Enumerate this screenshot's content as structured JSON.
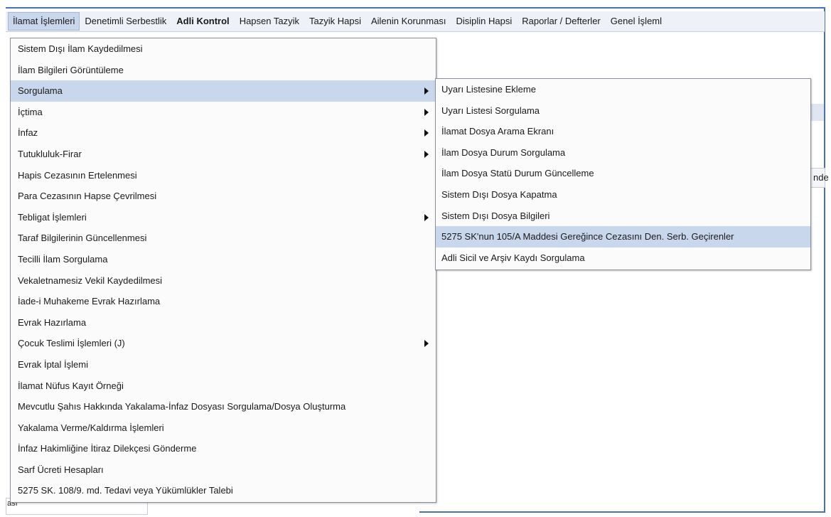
{
  "menubar": {
    "items": [
      {
        "label": "İlamat İşlemleri",
        "active": true
      },
      {
        "label": "Denetimli Serbestlik"
      },
      {
        "label": "Adli Kontrol",
        "bold": true
      },
      {
        "label": "Hapsen Tazyik"
      },
      {
        "label": "Tazyik Hapsi"
      },
      {
        "label": "Ailenin Korunması"
      },
      {
        "label": "Disiplin Hapsi"
      },
      {
        "label": "Raporlar / Defterler"
      },
      {
        "label": "Genel İşleml"
      }
    ]
  },
  "main_menu": {
    "items": [
      {
        "label": "Sistem Dışı İlam Kaydedilmesi"
      },
      {
        "label": "İlam Bilgileri Görüntüleme"
      },
      {
        "label": "Sorgulama",
        "submenu": true,
        "selected": true
      },
      {
        "label": "İçtima",
        "submenu": true
      },
      {
        "label": "İnfaz",
        "submenu": true
      },
      {
        "label": "Tutukluluk-Firar",
        "submenu": true
      },
      {
        "label": "Hapis Cezasının Ertelenmesi"
      },
      {
        "label": "Para Cezasının Hapse Çevrilmesi"
      },
      {
        "label": "Tebligat İşlemleri",
        "submenu": true
      },
      {
        "label": "Taraf Bilgilerinin Güncellenmesi"
      },
      {
        "label": "Tecilli İlam Sorgulama"
      },
      {
        "label": "Vekaletnamesiz Vekil Kaydedilmesi"
      },
      {
        "label": "İade-i Muhakeme Evrak Hazırlama"
      },
      {
        "label": "Evrak Hazırlama"
      },
      {
        "label": "Çocuk Teslimi İşlemleri (J)",
        "submenu": true
      },
      {
        "label": "Evrak İptal İşlemi"
      },
      {
        "label": "İlamat Nüfus Kayıt Örneği"
      },
      {
        "label": "Mevcutlu Şahıs Hakkında Yakalama-İnfaz Dosyası Sorgulama/Dosya Oluşturma"
      },
      {
        "label": "Yakalama Verme/Kaldırma İşlemleri"
      },
      {
        "label": "İnfaz Hakimliğine İtiraz Dilekçesi Gönderme"
      },
      {
        "label": "Sarf Ücreti Hesapları"
      },
      {
        "label": "5275 SK. 108/9. md. Tedavi veya Yükümlükler Talebi"
      }
    ]
  },
  "sub_menu": {
    "items": [
      {
        "label": "Uyarı Listesine Ekleme"
      },
      {
        "label": "Uyarı Listesi Sorgulama"
      },
      {
        "label": "İlamat Dosya Arama Ekranı"
      },
      {
        "label": "İlam Dosya Durum Sorgulama"
      },
      {
        "label": "İlam Dosya Statü Durum Güncelleme"
      },
      {
        "label": "Sistem Dışı Dosya Kapatma"
      },
      {
        "label": "Sistem Dışı Dosya Bilgileri"
      },
      {
        "label": "5275 SK'nun 105/A Maddesi Gereğince Cezasını Den. Serb. Geçirenler",
        "selected": true
      },
      {
        "label": "Adli Sicil ve Arşiv Kaydı Sorgulama"
      }
    ]
  },
  "background": {
    "clipped_right_text": "nde",
    "clipped_bottom_text": "ası"
  }
}
